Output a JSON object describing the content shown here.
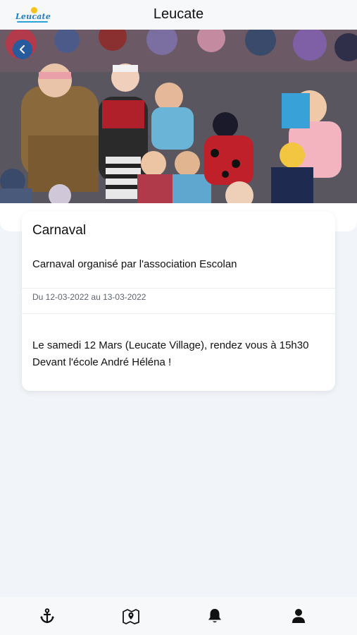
{
  "header": {
    "logo_text": "Leucate",
    "title": "Leucate"
  },
  "hero": {
    "image": "carnival-crowd-photo",
    "back_icon": "arrow-left-icon"
  },
  "event": {
    "title": "Carnaval",
    "subtitle": "Carnaval organisé par l'association Escolan",
    "dates": "Du 12-03-2022 au 13-03-2022",
    "description_line1": "Le samedi 12 Mars (Leucate Village), rendez vous à 15h30",
    "description_line2": "Devant l'école André Héléna !"
  },
  "tabbar": {
    "items": [
      {
        "icon": "anchor-icon"
      },
      {
        "icon": "map-pin-icon"
      },
      {
        "icon": "bell-icon"
      },
      {
        "icon": "user-icon"
      }
    ]
  },
  "colors": {
    "accent": "#1b5ea6",
    "logo_blue": "#1f7fc0",
    "logo_sun": "#f7c21a",
    "background": "#f1f4f8"
  }
}
